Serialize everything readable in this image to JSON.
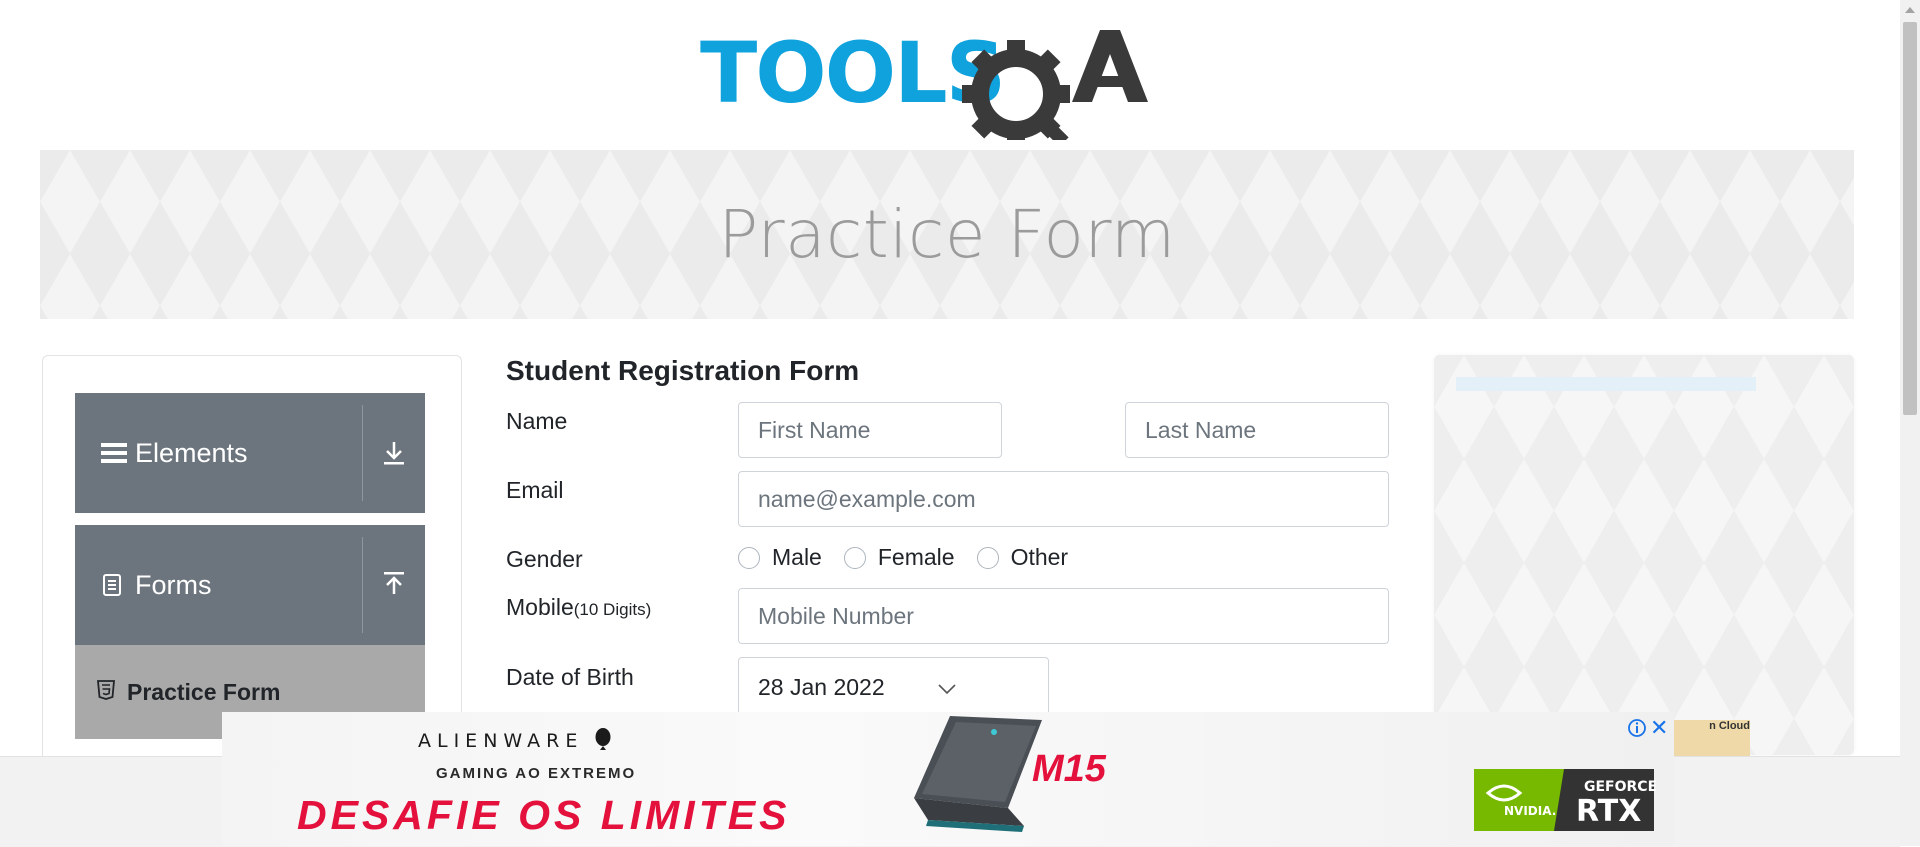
{
  "header": {
    "logo_text_tools": "TOOLS",
    "logo_text_qa": "QA",
    "logo_alt": "ToolsQA logo"
  },
  "banner": {
    "title": "Practice Form"
  },
  "sidebar": {
    "groups": [
      {
        "label": "Elements",
        "icon": "hamburger-icon",
        "arrow_icon": "download-arrow-icon",
        "expanded": false
      },
      {
        "label": "Forms",
        "icon": "document-icon",
        "arrow_icon": "upload-arrow-icon",
        "expanded": true
      }
    ],
    "items": [
      {
        "label": "Practice Form",
        "icon": "html5-icon",
        "active": true
      }
    ]
  },
  "form": {
    "title": "Student Registration Form",
    "name_label": "Name",
    "first_name_placeholder": "First Name",
    "last_name_placeholder": "Last Name",
    "email_label": "Email",
    "email_placeholder": "name@example.com",
    "gender_label": "Gender",
    "gender_options": [
      "Male",
      "Female",
      "Other"
    ],
    "mobile_label": "Mobile",
    "mobile_hint": "(10 Digits)",
    "mobile_placeholder": "Mobile Number",
    "dob_label": "Date of Birth",
    "dob_value": "28 Jan 2022"
  },
  "ad": {
    "brand": "ALIENWARE",
    "tagline": "GAMING AO EXTREMO",
    "headline": "DESAFIE OS LIMITES",
    "model": "M15",
    "badge_vendor": "NVIDIA.",
    "badge_line1": "GEFORCE",
    "badge_line2": "RTX",
    "close_symbol": "✕",
    "side_peek_text": "n Cloud"
  },
  "colors": {
    "tools_blue": "#0fa2dd",
    "qa_dark": "#3a3a3a",
    "sidebar_header": "#6c757d",
    "sidebar_active": "#a9a9a9",
    "ad_red": "#e3113c",
    "nvidia_green": "#76b900"
  }
}
